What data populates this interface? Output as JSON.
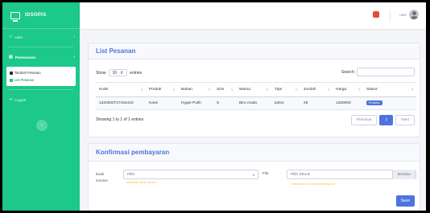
{
  "brand": {
    "name": "IDSOPIS"
  },
  "sidebar": {
    "items": [
      {
        "icon": "user-icon",
        "label": "User",
        "glyph": "⚇"
      },
      {
        "icon": "list-icon",
        "label": "Pemesanan",
        "glyph": "▤"
      },
      {
        "icon": "logout-icon",
        "label": "Logout",
        "glyph": "⇥"
      }
    ],
    "submenu": [
      {
        "label": "Tambah Pesanan"
      },
      {
        "label": "List Pesanan"
      }
    ],
    "toggle_glyph": "‹"
  },
  "topbar": {
    "user_name": "user"
  },
  "list_card": {
    "title": "List Pesanan",
    "show_label": "Show",
    "entries_value": "10",
    "entries_label": "entries",
    "search_label": "Search:",
    "columns": [
      "Kode",
      "Produk",
      "Bahan",
      "Size",
      "Warna",
      "Tipe",
      "Jumlah",
      "Harga",
      "Status"
    ],
    "rows": [
      [
        "1320200727154419",
        "Kaos",
        "Hyget Putih",
        "S",
        "Biru muda",
        "polos",
        "25",
        "1250000",
        "Produksi"
      ]
    ],
    "info": "Showing 1 to 1 of 1 entries",
    "pagination": {
      "previous": "Previous",
      "page": "1",
      "next": "Next"
    }
  },
  "confirm_card": {
    "title": "Konfirmasi pembayaran",
    "kode_label": "kode",
    "invoice_label": "invoice",
    "select_placeholder": "Pilih",
    "select_hint": "Masukan kode invoice",
    "file_label": "File",
    "file_placeholder": "Pilih Struck",
    "browse_label": "Browse",
    "file_hint": "Masukan foto bukti pembayaran",
    "save_label": "Save"
  },
  "colors": {
    "sidebar": "#1cc88a",
    "primary": "#4e73df",
    "warning": "#f6c23e",
    "danger": "#e74a3b"
  }
}
